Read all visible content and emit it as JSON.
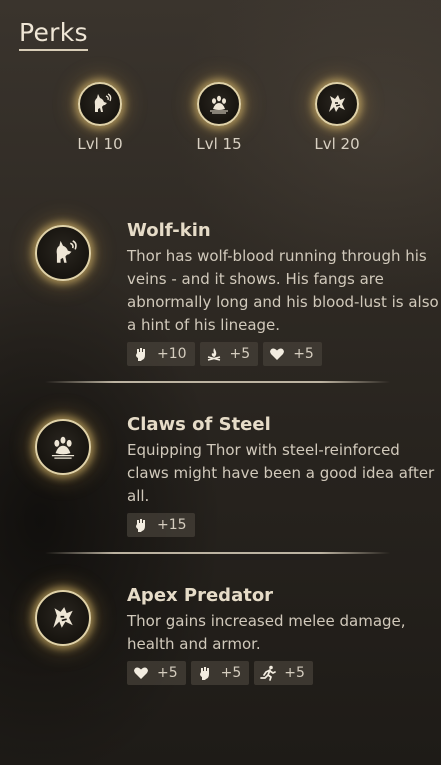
{
  "header": {
    "title": "Perks"
  },
  "level_badges": [
    {
      "icon": "wolf-howl-icon",
      "label": "Lvl 10"
    },
    {
      "icon": "paw-icon",
      "label": "Lvl 15"
    },
    {
      "icon": "predator-beast-icon",
      "label": "Lvl 20"
    }
  ],
  "perks": [
    {
      "icon": "wolf-howl-icon",
      "name": "Wolf-kin",
      "description": "Thor has wolf-blood running through his veins - and it shows. His fangs are abnormally long and his blood-lust is also a hint of his lineage.",
      "stats": [
        {
          "icon": "fist-icon",
          "value": "+10"
        },
        {
          "icon": "campfire-icon",
          "value": "+5"
        },
        {
          "icon": "heart-icon",
          "value": "+5"
        }
      ]
    },
    {
      "icon": "paw-icon",
      "name": "Claws of Steel",
      "description": "Equipping Thor with steel-reinforced claws might have been a good idea after all.",
      "stats": [
        {
          "icon": "fist-icon",
          "value": "+15"
        }
      ]
    },
    {
      "icon": "predator-beast-icon",
      "name": "Apex Predator",
      "description": "Thor gains increased melee damage, health and armor.",
      "stats": [
        {
          "icon": "heart-icon",
          "value": "+5"
        },
        {
          "icon": "fist-icon",
          "value": "+5"
        },
        {
          "icon": "running-icon",
          "value": "+5"
        }
      ]
    }
  ],
  "colors": {
    "glow": "#f0cd78",
    "text": "#d9d2c4",
    "chip_bg": "#464038"
  }
}
